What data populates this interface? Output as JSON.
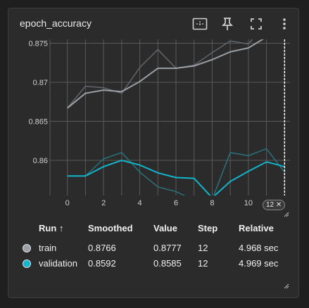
{
  "card": {
    "title": "epoch_accuracy",
    "icons": [
      "fit-domain-icon",
      "pin-icon",
      "fullscreen-icon",
      "more-vert-icon"
    ]
  },
  "chart_data": {
    "type": "line",
    "title": "epoch_accuracy",
    "xlabel": "",
    "ylabel": "",
    "xlim": [
      -1,
      12.3
    ],
    "ylim": [
      0.8555,
      0.8755
    ],
    "xticks": [
      0,
      2,
      4,
      6,
      8,
      10
    ],
    "yticks": [
      0.86,
      0.865,
      0.87,
      0.875
    ],
    "ytick_labels": [
      "0.86",
      "0.865",
      "0.87",
      "0.875"
    ],
    "grid": true,
    "step_marker": 12,
    "series": [
      {
        "name": "train",
        "color": "#9aa0a6",
        "raw_color": "#5f6368",
        "smoothed": [
          0.8667,
          0.8686,
          0.869,
          0.8688,
          0.8701,
          0.8718,
          0.8718,
          0.8721,
          0.8729,
          0.8739,
          0.8744,
          0.8758,
          0.8766
        ],
        "raw": [
          0.8667,
          0.8695,
          0.8693,
          0.8686,
          0.8719,
          0.8742,
          0.8718,
          0.8722,
          0.8738,
          0.8753,
          0.8749,
          0.8777,
          0.8777
        ]
      },
      {
        "name": "validation",
        "color": "#12b5cb",
        "raw_color": "#2a6f77",
        "smoothed": [
          0.858,
          0.858,
          0.8592,
          0.86,
          0.8594,
          0.8584,
          0.8578,
          0.8577,
          0.8552,
          0.8573,
          0.8586,
          0.8598,
          0.8592
        ],
        "raw": [
          0.858,
          0.858,
          0.8602,
          0.861,
          0.8585,
          0.8566,
          0.856,
          0.8549,
          0.855,
          0.861,
          0.8606,
          0.8615,
          0.8585
        ]
      }
    ]
  },
  "step_badge": "12 ✕",
  "table": {
    "headers": [
      "Run ↑",
      "Smoothed",
      "Value",
      "Step",
      "Relative"
    ],
    "rows": [
      {
        "run": "train",
        "smoothed": "0.8766",
        "value": "0.8777",
        "step": "12",
        "relative": "4.968 sec",
        "color": "#9aa0a6"
      },
      {
        "run": "validation",
        "smoothed": "0.8592",
        "value": "0.8585",
        "step": "12",
        "relative": "4.969 sec",
        "color": "#12b5cb"
      }
    ]
  }
}
